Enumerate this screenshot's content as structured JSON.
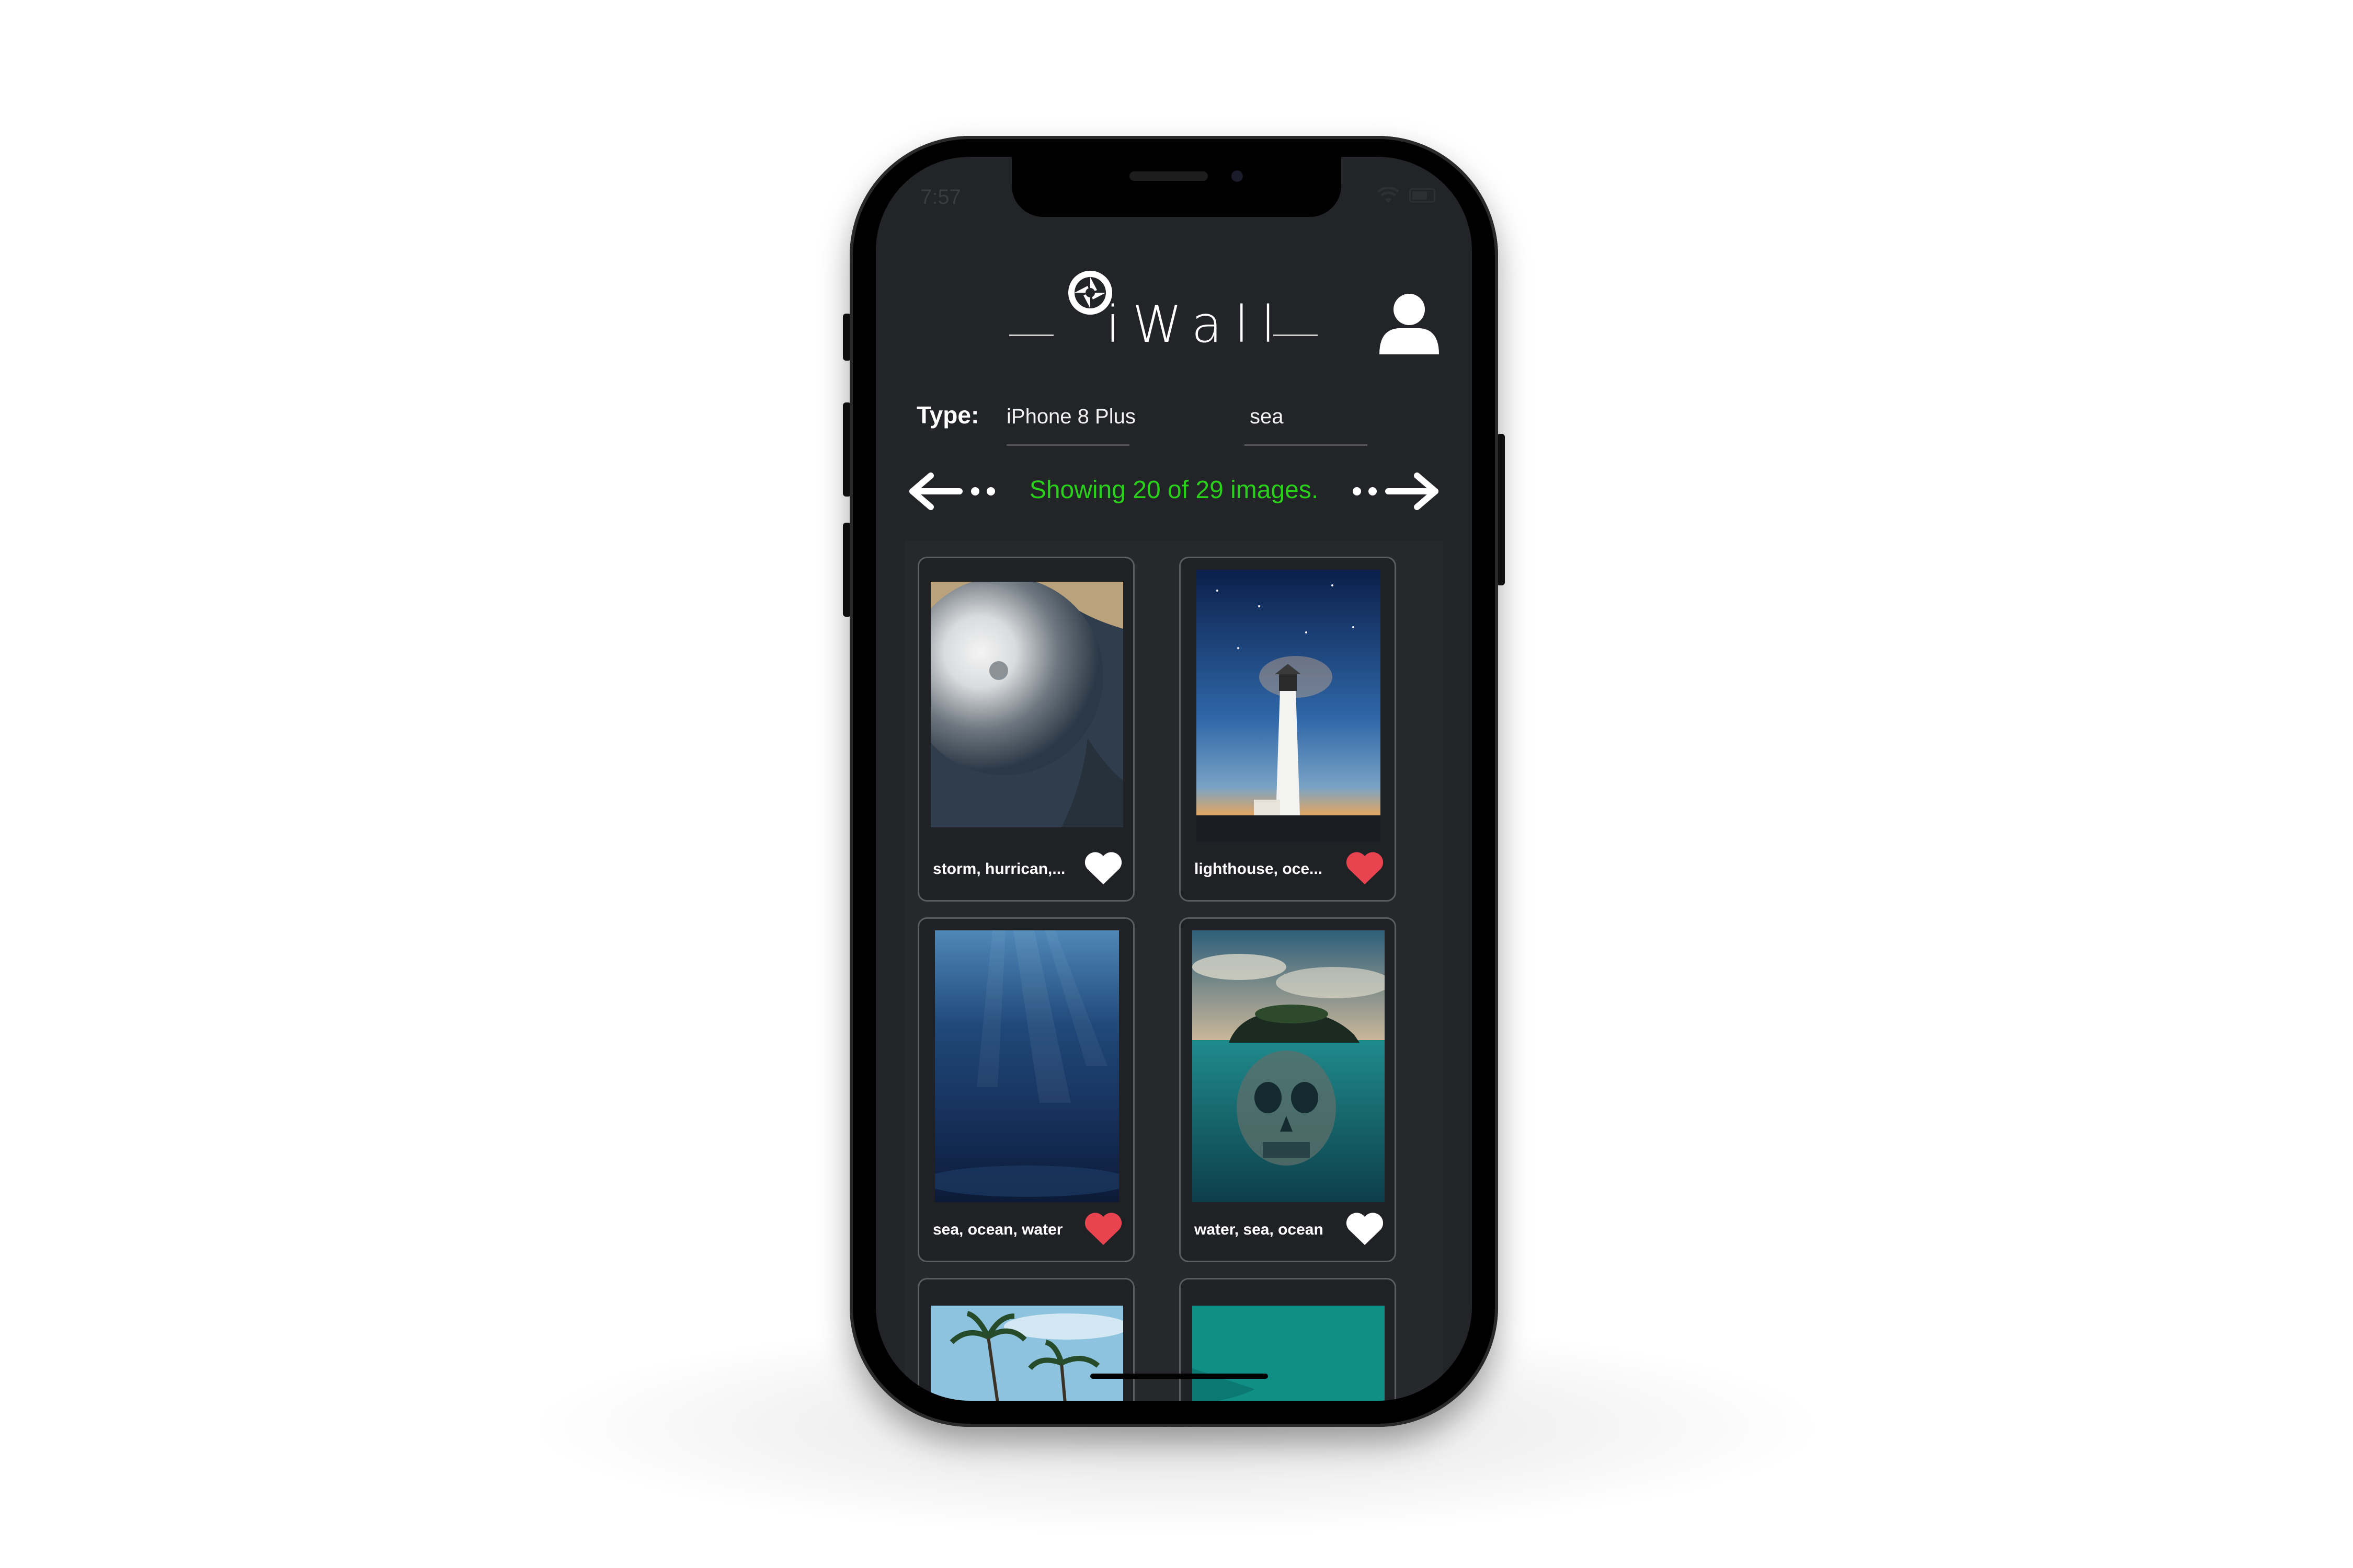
{
  "status": {
    "time": "7:57"
  },
  "app": {
    "name": "iWall"
  },
  "filters": {
    "type_label": "Type:",
    "device": "iPhone 8 Plus",
    "keyword": "sea"
  },
  "pagination": {
    "summary": "Showing 20 of 29 images.",
    "prev_icon": "arrow-left-icon",
    "next_icon": "arrow-right-icon"
  },
  "colors": {
    "summary_text": "#2ad11b",
    "heart_liked": "#e8434e",
    "heart_default": "#ffffff",
    "background": "#232427"
  },
  "wallpapers": [
    {
      "caption": "storm, hurrican,...",
      "liked": false
    },
    {
      "caption": "lighthouse, oce...",
      "liked": true
    },
    {
      "caption": "sea, ocean, water",
      "liked": true
    },
    {
      "caption": "water, sea, ocean",
      "liked": false
    },
    {
      "caption": "",
      "liked": false
    },
    {
      "caption": "",
      "liked": false
    }
  ]
}
